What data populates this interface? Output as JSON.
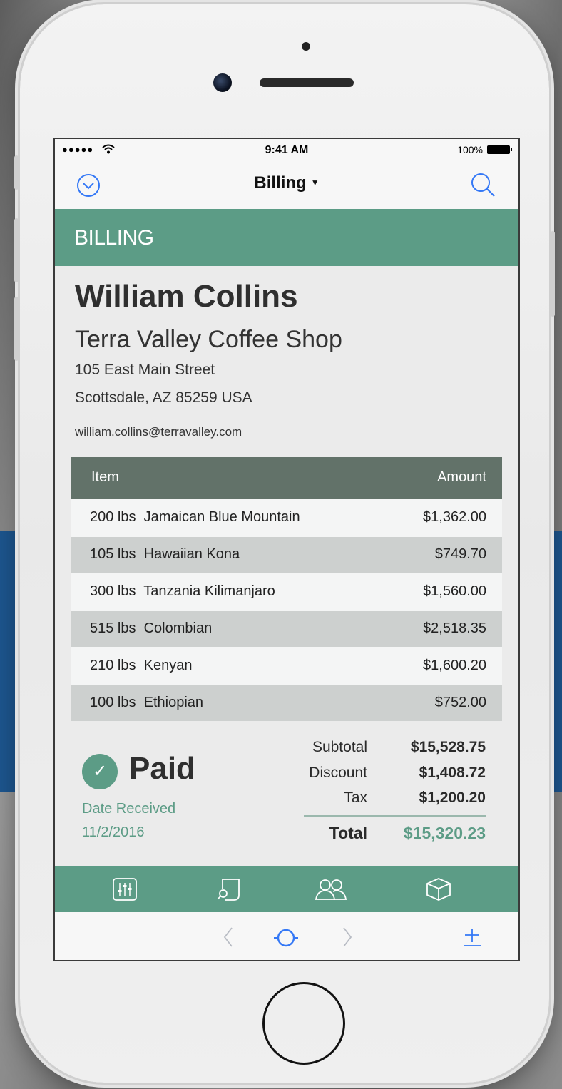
{
  "status": {
    "signal": "●●●●●",
    "wifi": "ᯤ",
    "time": "9:41 AM",
    "battery": "100%"
  },
  "nav": {
    "title": "Billing",
    "caret": "▼",
    "left_icon": "chevron-circle-down-icon",
    "right_icon": "search-icon"
  },
  "section": {
    "header": "BILLING"
  },
  "customer": {
    "name": "William Collins",
    "company": "Terra Valley Coffee Shop",
    "address_line1": "105 East Main Street",
    "address_line2": "Scottsdale, AZ 85259 USA",
    "email": "william.collins@terravalley.com"
  },
  "table": {
    "columns": [
      "Item",
      "Amount"
    ],
    "rows": [
      {
        "item": "200 lbs  Jamaican Blue Mountain",
        "amount": "$1,362.00"
      },
      {
        "item": "105 lbs  Hawaiian Kona",
        "amount": "$749.70"
      },
      {
        "item": "300 lbs  Tanzania Kilimanjaro",
        "amount": "$1,560.00"
      },
      {
        "item": "515 lbs  Colombian",
        "amount": "$2,518.35"
      },
      {
        "item": "210 lbs  Kenyan",
        "amount": "$1,600.20"
      },
      {
        "item": "100 lbs  Ethiopian",
        "amount": "$752.00"
      }
    ]
  },
  "payment": {
    "status": "Paid",
    "check": "✓",
    "date_label": "Date Received",
    "date": "11/2/2016"
  },
  "summary": {
    "subtotal_label": "Subtotal",
    "subtotal": "$15,528.75",
    "discount_label": "Discount",
    "discount": "$1,408.72",
    "tax_label": "Tax",
    "tax": "$1,200.20",
    "total_label": "Total",
    "total": "$15,320.23"
  },
  "tabbar": {
    "icons": [
      "sliders-icon",
      "document-search-icon",
      "people-icon",
      "box-icon"
    ]
  },
  "toolbar": {
    "icons": [
      "back-chevron-icon",
      "record-circle-icon",
      "forward-chevron-icon",
      "add-icon"
    ]
  },
  "colors": {
    "accent_green": "#5c9c86",
    "table_header": "#627269",
    "ios_blue": "#3478f6",
    "background_band": "#1d568f"
  }
}
